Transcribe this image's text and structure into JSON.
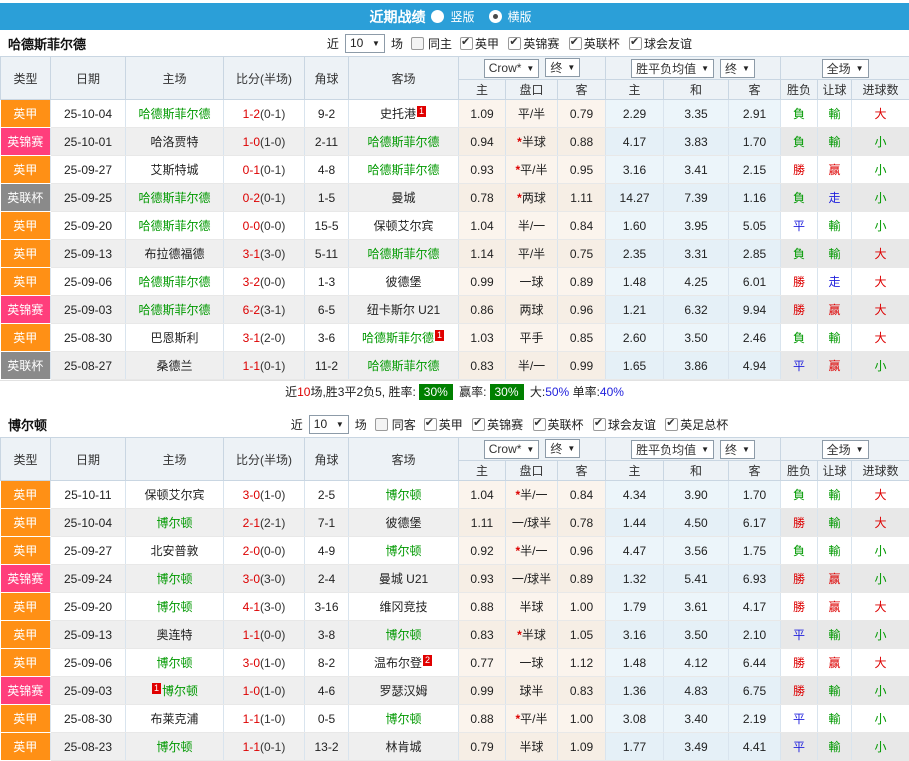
{
  "topbar": {
    "title": "近期战绩",
    "options": [
      {
        "label": "竖版",
        "selected": false
      },
      {
        "label": "横版",
        "selected": true
      }
    ]
  },
  "colors": {
    "topbar_bg": "#2b9fd8",
    "league": {
      "英甲": "#ff9015",
      "英锦赛": "#ff3e7c",
      "英联杯": "#8a8a8a",
      "英足总杯": "#cc8833"
    },
    "result": {
      "勝": "#dd0000",
      "負": "#009900",
      "平": "#2222dd",
      "赢": "#dd0000",
      "輸": "#009900",
      "走": "#2222dd",
      "大": "#dd0000",
      "小": "#009900"
    }
  },
  "table_header": {
    "cols": [
      "类型",
      "日期",
      "主场",
      "比分(半场)",
      "角球",
      "客场"
    ],
    "sub": [
      "主",
      "盘口",
      "客",
      "主",
      "和",
      "客",
      "胜负",
      "让球",
      "进球数"
    ],
    "selects": {
      "crow": "Crow*",
      "end1": "终",
      "mean": "胜平负均值",
      "end2": "终",
      "full": "全场"
    }
  },
  "sections": [
    {
      "team": "哈德斯菲尔德",
      "filter": {
        "near": "近",
        "count": "10",
        "games": "场",
        "same": "同主",
        "same_checked": false,
        "leagues": [
          "英甲",
          "英锦赛",
          "英联杯",
          "球会友谊"
        ]
      },
      "rows": [
        {
          "type": "英甲",
          "date": "25-10-04",
          "home": "哈德斯菲尔德",
          "home_sub": true,
          "home_card": "",
          "home_card_pre": false,
          "away": "史托港",
          "away_sub": false,
          "away_card": "1",
          "score": "1-2",
          "half": "(0-1)",
          "corners": "9-2",
          "oh": "1.09",
          "pan": "平/半",
          "star": false,
          "oa": "0.79",
          "mh": "2.29",
          "md": "3.35",
          "ma": "2.91",
          "r1": "負",
          "r2": "輸",
          "r3": "大"
        },
        {
          "type": "英锦赛",
          "date": "25-10-01",
          "home": "哈洛贾特",
          "home_sub": false,
          "home_card": "",
          "home_card_pre": false,
          "away": "哈德斯菲尔德",
          "away_sub": true,
          "away_card": "",
          "score": "1-0",
          "half": "(1-0)",
          "corners": "2-11",
          "oh": "0.94",
          "pan": "半球",
          "star": true,
          "oa": "0.88",
          "mh": "4.17",
          "md": "3.83",
          "ma": "1.70",
          "r1": "負",
          "r2": "輸",
          "r3": "小"
        },
        {
          "type": "英甲",
          "date": "25-09-27",
          "home": "艾斯特城",
          "home_sub": false,
          "home_card": "",
          "home_card_pre": false,
          "away": "哈德斯菲尔德",
          "away_sub": true,
          "away_card": "",
          "score": "0-1",
          "half": "(0-1)",
          "corners": "4-8",
          "oh": "0.93",
          "pan": "平/半",
          "star": true,
          "oa": "0.95",
          "mh": "3.16",
          "md": "3.41",
          "ma": "2.15",
          "r1": "勝",
          "r2": "赢",
          "r3": "小"
        },
        {
          "type": "英联杯",
          "date": "25-09-25",
          "home": "哈德斯菲尔德",
          "home_sub": true,
          "home_card": "",
          "home_card_pre": false,
          "away": "曼城",
          "away_sub": false,
          "away_card": "",
          "score": "0-2",
          "half": "(0-1)",
          "corners": "1-5",
          "oh": "0.78",
          "pan": "两球",
          "star": true,
          "oa": "1.11",
          "mh": "14.27",
          "md": "7.39",
          "ma": "1.16",
          "r1": "負",
          "r2": "走",
          "r3": "小"
        },
        {
          "type": "英甲",
          "date": "25-09-20",
          "home": "哈德斯菲尔德",
          "home_sub": true,
          "home_card": "",
          "home_card_pre": false,
          "away": "保顿艾尔宾",
          "away_sub": false,
          "away_card": "",
          "score": "0-0",
          "half": "(0-0)",
          "corners": "15-5",
          "oh": "1.04",
          "pan": "半/一",
          "star": false,
          "oa": "0.84",
          "mh": "1.60",
          "md": "3.95",
          "ma": "5.05",
          "r1": "平",
          "r2": "輸",
          "r3": "小"
        },
        {
          "type": "英甲",
          "date": "25-09-13",
          "home": "布拉德福德",
          "home_sub": false,
          "home_card": "",
          "home_card_pre": false,
          "away": "哈德斯菲尔德",
          "away_sub": true,
          "away_card": "",
          "score": "3-1",
          "half": "(3-0)",
          "corners": "5-11",
          "oh": "1.14",
          "pan": "平/半",
          "star": false,
          "oa": "0.75",
          "mh": "2.35",
          "md": "3.31",
          "ma": "2.85",
          "r1": "負",
          "r2": "輸",
          "r3": "大"
        },
        {
          "type": "英甲",
          "date": "25-09-06",
          "home": "哈德斯菲尔德",
          "home_sub": true,
          "home_card": "",
          "home_card_pre": false,
          "away": "彼德堡",
          "away_sub": false,
          "away_card": "",
          "score": "3-2",
          "half": "(0-0)",
          "corners": "1-3",
          "oh": "0.99",
          "pan": "一球",
          "star": false,
          "oa": "0.89",
          "mh": "1.48",
          "md": "4.25",
          "ma": "6.01",
          "r1": "勝",
          "r2": "走",
          "r3": "大"
        },
        {
          "type": "英锦赛",
          "date": "25-09-03",
          "home": "哈德斯菲尔德",
          "home_sub": true,
          "home_card": "",
          "home_card_pre": false,
          "away": "纽卡斯尔 U21",
          "away_sub": false,
          "away_card": "",
          "score": "6-2",
          "half": "(3-1)",
          "corners": "6-5",
          "oh": "0.86",
          "pan": "两球",
          "star": false,
          "oa": "0.96",
          "mh": "1.21",
          "md": "6.32",
          "ma": "9.94",
          "r1": "勝",
          "r2": "赢",
          "r3": "大"
        },
        {
          "type": "英甲",
          "date": "25-08-30",
          "home": "巴恩斯利",
          "home_sub": false,
          "home_card": "",
          "home_card_pre": false,
          "away": "哈德斯菲尔德",
          "away_sub": true,
          "away_card": "1",
          "score": "3-1",
          "half": "(2-0)",
          "corners": "3-6",
          "oh": "1.03",
          "pan": "平手",
          "star": false,
          "oa": "0.85",
          "mh": "2.60",
          "md": "3.50",
          "ma": "2.46",
          "r1": "負",
          "r2": "輸",
          "r3": "大"
        },
        {
          "type": "英联杯",
          "date": "25-08-27",
          "home": "桑德兰",
          "home_sub": false,
          "home_card": "",
          "home_card_pre": false,
          "away": "哈德斯菲尔德",
          "away_sub": true,
          "away_card": "",
          "score": "1-1",
          "half": "(0-1)",
          "corners": "11-2",
          "oh": "0.83",
          "pan": "半/一",
          "star": false,
          "oa": "0.99",
          "mh": "1.65",
          "md": "3.86",
          "ma": "4.94",
          "r1": "平",
          "r2": "赢",
          "r3": "小"
        }
      ],
      "summary": [
        {
          "t": "近",
          "c": "black"
        },
        {
          "t": "10",
          "c": "red"
        },
        {
          "t": "场,胜3平2负5, 胜率:",
          "c": "black"
        },
        {
          "t": "30%",
          "c": "badge"
        },
        {
          "t": " 赢率:",
          "c": "black"
        },
        {
          "t": "30%",
          "c": "badge"
        },
        {
          "t": " 大:",
          "c": "black"
        },
        {
          "t": "50%",
          "c": "blue"
        },
        {
          "t": " 单率:",
          "c": "black"
        },
        {
          "t": "40%",
          "c": "blue"
        }
      ]
    },
    {
      "team": "博尔顿",
      "filter": {
        "near": "近",
        "count": "10",
        "games": "场",
        "same": "同客",
        "same_checked": false,
        "leagues": [
          "英甲",
          "英锦赛",
          "英联杯",
          "球会友谊",
          "英足总杯"
        ]
      },
      "rows": [
        {
          "type": "英甲",
          "date": "25-10-11",
          "home": "保顿艾尔宾",
          "home_sub": false,
          "home_card": "",
          "home_card_pre": false,
          "away": "博尔顿",
          "away_sub": true,
          "away_card": "",
          "score": "3-0",
          "half": "(1-0)",
          "corners": "2-5",
          "oh": "1.04",
          "pan": "半/一",
          "star": true,
          "oa": "0.84",
          "mh": "4.34",
          "md": "3.90",
          "ma": "1.70",
          "r1": "負",
          "r2": "輸",
          "r3": "大"
        },
        {
          "type": "英甲",
          "date": "25-10-04",
          "home": "博尔顿",
          "home_sub": true,
          "home_card": "",
          "home_card_pre": false,
          "away": "彼德堡",
          "away_sub": false,
          "away_card": "",
          "score": "2-1",
          "half": "(2-1)",
          "corners": "7-1",
          "oh": "1.11",
          "pan": "一/球半",
          "star": false,
          "oa": "0.78",
          "mh": "1.44",
          "md": "4.50",
          "ma": "6.17",
          "r1": "勝",
          "r2": "輸",
          "r3": "大"
        },
        {
          "type": "英甲",
          "date": "25-09-27",
          "home": "北安普敦",
          "home_sub": false,
          "home_card": "",
          "home_card_pre": false,
          "away": "博尔顿",
          "away_sub": true,
          "away_card": "",
          "score": "2-0",
          "half": "(0-0)",
          "corners": "4-9",
          "oh": "0.92",
          "pan": "半/一",
          "star": true,
          "oa": "0.96",
          "mh": "4.47",
          "md": "3.56",
          "ma": "1.75",
          "r1": "負",
          "r2": "輸",
          "r3": "小"
        },
        {
          "type": "英锦赛",
          "date": "25-09-24",
          "home": "博尔顿",
          "home_sub": true,
          "home_card": "",
          "home_card_pre": false,
          "away": "曼城 U21",
          "away_sub": false,
          "away_card": "",
          "score": "3-0",
          "half": "(3-0)",
          "corners": "2-4",
          "oh": "0.93",
          "pan": "一/球半",
          "star": false,
          "oa": "0.89",
          "mh": "1.32",
          "md": "5.41",
          "ma": "6.93",
          "r1": "勝",
          "r2": "赢",
          "r3": "小"
        },
        {
          "type": "英甲",
          "date": "25-09-20",
          "home": "博尔顿",
          "home_sub": true,
          "home_card": "",
          "home_card_pre": false,
          "away": "维冈竞技",
          "away_sub": false,
          "away_card": "",
          "score": "4-1",
          "half": "(3-0)",
          "corners": "3-16",
          "oh": "0.88",
          "pan": "半球",
          "star": false,
          "oa": "1.00",
          "mh": "1.79",
          "md": "3.61",
          "ma": "4.17",
          "r1": "勝",
          "r2": "赢",
          "r3": "大"
        },
        {
          "type": "英甲",
          "date": "25-09-13",
          "home": "奥连特",
          "home_sub": false,
          "home_card": "",
          "home_card_pre": false,
          "away": "博尔顿",
          "away_sub": true,
          "away_card": "",
          "score": "1-1",
          "half": "(0-0)",
          "corners": "3-8",
          "oh": "0.83",
          "pan": "半球",
          "star": true,
          "oa": "1.05",
          "mh": "3.16",
          "md": "3.50",
          "ma": "2.10",
          "r1": "平",
          "r2": "輸",
          "r3": "小"
        },
        {
          "type": "英甲",
          "date": "25-09-06",
          "home": "博尔顿",
          "home_sub": true,
          "home_card": "",
          "home_card_pre": false,
          "away": "温布尔登",
          "away_sub": false,
          "away_card": "2",
          "score": "3-0",
          "half": "(1-0)",
          "corners": "8-2",
          "oh": "0.77",
          "pan": "一球",
          "star": false,
          "oa": "1.12",
          "mh": "1.48",
          "md": "4.12",
          "ma": "6.44",
          "r1": "勝",
          "r2": "赢",
          "r3": "大"
        },
        {
          "type": "英锦赛",
          "date": "25-09-03",
          "home": "博尔顿",
          "home_sub": true,
          "home_card": "1",
          "home_card_pre": true,
          "away": "罗瑟汉姆",
          "away_sub": false,
          "away_card": "",
          "score": "1-0",
          "half": "(1-0)",
          "corners": "4-6",
          "oh": "0.99",
          "pan": "球半",
          "star": false,
          "oa": "0.83",
          "mh": "1.36",
          "md": "4.83",
          "ma": "6.75",
          "r1": "勝",
          "r2": "輸",
          "r3": "小"
        },
        {
          "type": "英甲",
          "date": "25-08-30",
          "home": "布莱克浦",
          "home_sub": false,
          "home_card": "",
          "home_card_pre": false,
          "away": "博尔顿",
          "away_sub": true,
          "away_card": "",
          "score": "1-1",
          "half": "(1-0)",
          "corners": "0-5",
          "oh": "0.88",
          "pan": "平/半",
          "star": true,
          "oa": "1.00",
          "mh": "3.08",
          "md": "3.40",
          "ma": "2.19",
          "r1": "平",
          "r2": "輸",
          "r3": "小"
        },
        {
          "type": "英甲",
          "date": "25-08-23",
          "home": "博尔顿",
          "home_sub": true,
          "home_card": "",
          "home_card_pre": false,
          "away": "林肯城",
          "away_sub": false,
          "away_card": "",
          "score": "1-1",
          "half": "(0-1)",
          "corners": "13-2",
          "oh": "0.79",
          "pan": "半球",
          "star": false,
          "oa": "1.09",
          "mh": "1.77",
          "md": "3.49",
          "ma": "4.41",
          "r1": "平",
          "r2": "輸",
          "r3": "小"
        }
      ],
      "summary": null
    }
  ]
}
